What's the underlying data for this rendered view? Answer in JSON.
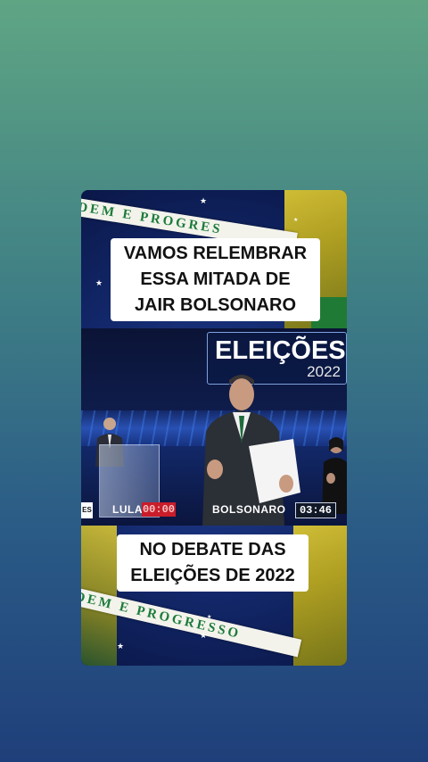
{
  "caption_top": {
    "line1": "VAMOS RELEMBRAR",
    "line2": "ESSA MITADA DE",
    "line3": "JAIR BOLSONARO"
  },
  "caption_bottom": {
    "line1": "NO DEBATE DAS",
    "line2": "ELEIÇÕES DE 2022"
  },
  "flag_band_top": "DEM E PROGRES",
  "flag_band_bottom": "DEM E PROGRESSO",
  "video": {
    "logo_title": "ELEIÇÕES",
    "logo_year": "2022",
    "left_tag": "ES",
    "candidate_left": "LULA",
    "candidate_left_time": "00:00",
    "candidate_right": "BOLSONARO",
    "candidate_right_time": "03:46"
  },
  "colors": {
    "flag_blue": "#13286b",
    "flag_yellow": "#d9c534",
    "flag_green": "#1f7a35",
    "band_text": "#1c7b3a",
    "timer_red": "#c91d2a"
  }
}
